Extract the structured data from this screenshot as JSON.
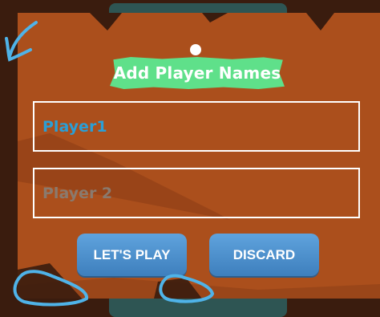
{
  "dialog": {
    "title": "Add Player Names"
  },
  "inputs": {
    "player1_value": "Player1",
    "player2_placeholder": "Player 2"
  },
  "buttons": {
    "play_label": "LET'S PLAY",
    "discard_label": "DISCARD"
  },
  "colors": {
    "panel": "#ab4f1c",
    "title_banner": "#5fe08a",
    "button": "#4a90d0",
    "player1_text": "#2a9fd6",
    "annotation": "#4fb3e8"
  }
}
